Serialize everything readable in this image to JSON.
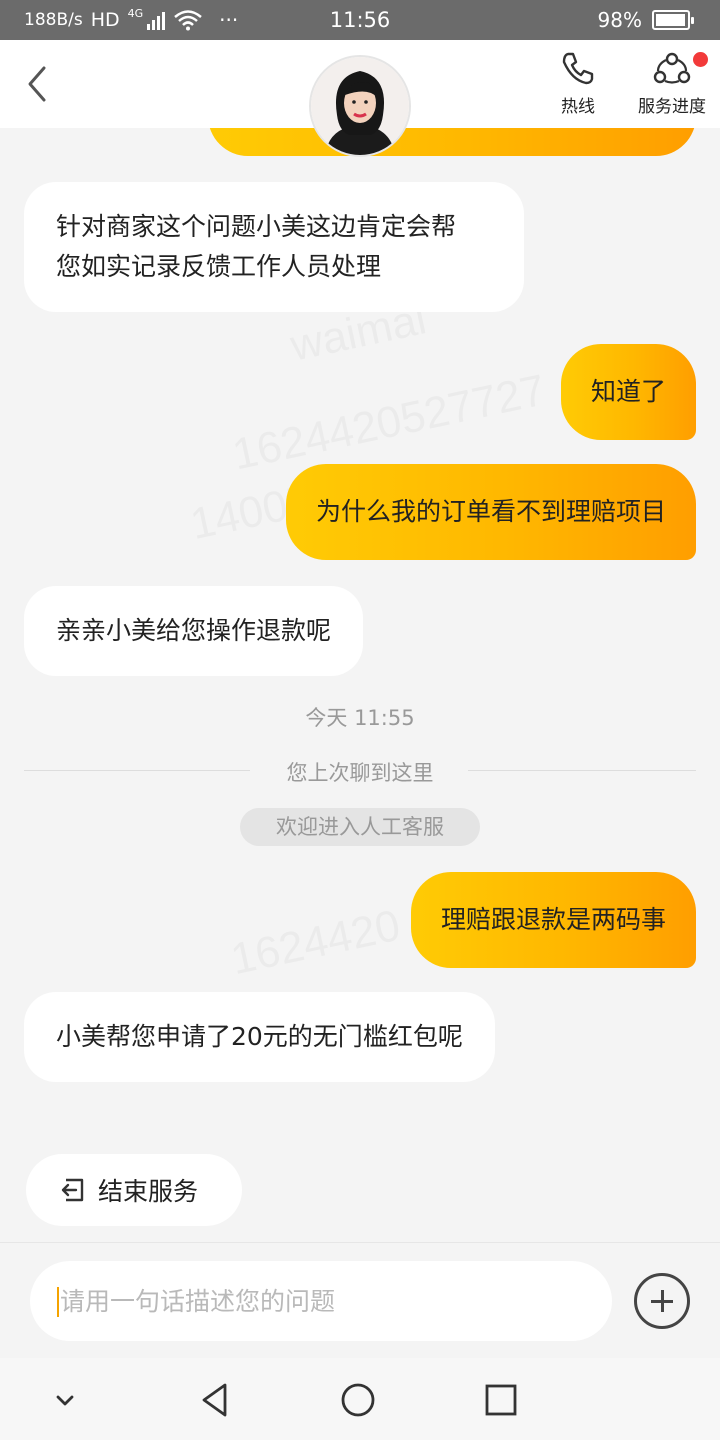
{
  "status_bar": {
    "net_speed": "188B/s",
    "hd": "HD",
    "network_type": "4G",
    "more": "···",
    "time": "11:56",
    "battery": "98%",
    "battery_level": 0.98
  },
  "header": {
    "hotline_label": "热线",
    "service_progress_label": "服务进度",
    "has_notification": true
  },
  "messages": [
    {
      "side": "in",
      "text_lines": [
        "针对商家这个问题小美这边肯定会帮",
        "您如实记录反馈工作人员处理"
      ]
    },
    {
      "side": "out",
      "text": "知道了"
    },
    {
      "side": "out",
      "text": "为什么我的订单看不到理赔项目"
    },
    {
      "side": "in",
      "text": "亲亲小美给您操作退款呢"
    },
    {
      "side": "out",
      "text": "理赔跟退款是两码事"
    },
    {
      "side": "in",
      "text": "小美帮您申请了20元的无门槛红包呢"
    }
  ],
  "system": {
    "time_stamp": "今天 11:55",
    "last_chat_divider": "您上次聊到这里",
    "welcome_pill": "欢迎进入人工客服"
  },
  "end_service_label": "结束服务",
  "input": {
    "placeholder": "请用一句话描述您的问题",
    "value": ""
  },
  "colors": {
    "accent_start": "#ffcb05",
    "accent_end": "#ff9e00",
    "notification": "#f23a3a",
    "status_bar": "#6b6b6b",
    "background": "#f4f4f4"
  },
  "icons": [
    "back-arrow-icon",
    "phone-icon",
    "service-progress-icon",
    "exit-icon",
    "plus-icon",
    "collapse-chevron-icon",
    "back-triangle-icon",
    "home-circle-icon",
    "recents-square-icon"
  ]
}
